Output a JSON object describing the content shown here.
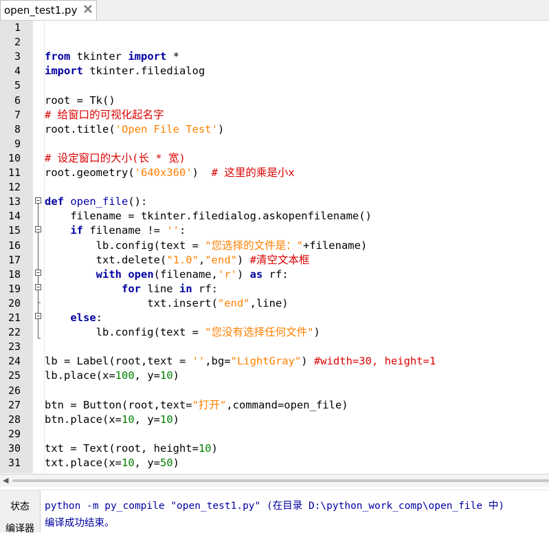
{
  "tab": {
    "filename": "open_test1.py",
    "close_icon": "close-x-icon"
  },
  "editor": {
    "line_numbers": [
      "1",
      "2",
      "3",
      "4",
      "5",
      "6",
      "7",
      "8",
      "9",
      "10",
      "11",
      "12",
      "13",
      "14",
      "15",
      "16",
      "17",
      "18",
      "19",
      "20",
      "21",
      "22",
      "23",
      "24",
      "25",
      "26",
      "27",
      "28",
      "29",
      "30",
      "31"
    ],
    "lines": [
      [],
      [],
      [
        [
          "kw",
          "from"
        ],
        [
          "op",
          " tkinter "
        ],
        [
          "kw",
          "import"
        ],
        [
          "op",
          " *"
        ]
      ],
      [
        [
          "kw",
          "import"
        ],
        [
          "op",
          " tkinter.filedialog"
        ]
      ],
      [],
      [
        [
          "op",
          "root = Tk()"
        ]
      ],
      [
        [
          "cm",
          "# 给窗口的可视化起名字"
        ]
      ],
      [
        [
          "op",
          "root.title("
        ],
        [
          "str",
          "'Open File Test'"
        ],
        [
          "op",
          ")"
        ]
      ],
      [],
      [
        [
          "cm",
          "# 设定窗口的大小(长 * 宽)"
        ]
      ],
      [
        [
          "op",
          "root.geometry("
        ],
        [
          "str",
          "'640x360'"
        ],
        [
          "op",
          ")  "
        ],
        [
          "cm",
          "# 这里的乘是小x"
        ]
      ],
      [],
      [
        [
          "kw",
          "def"
        ],
        [
          "op",
          " "
        ],
        [
          "bi",
          "open_file"
        ],
        [
          "op",
          "():"
        ]
      ],
      [
        [
          "op",
          "    filename = tkinter.filedialog.askopenfilename()"
        ]
      ],
      [
        [
          "op",
          "    "
        ],
        [
          "kw",
          "if"
        ],
        [
          "op",
          " filename != "
        ],
        [
          "str",
          "''"
        ],
        [
          "op",
          ":"
        ]
      ],
      [
        [
          "op",
          "        lb.config(text = "
        ],
        [
          "str",
          "\"您选择的文件是：\""
        ],
        [
          "op",
          "+filename)"
        ]
      ],
      [
        [
          "op",
          "        txt.delete("
        ],
        [
          "str",
          "\"1.0\""
        ],
        [
          "op",
          ","
        ],
        [
          "str",
          "\"end\""
        ],
        [
          "op",
          ") "
        ],
        [
          "cm",
          "#清空文本框"
        ]
      ],
      [
        [
          "op",
          "        "
        ],
        [
          "kw",
          "with"
        ],
        [
          "op",
          " "
        ],
        [
          "kw",
          "open"
        ],
        [
          "op",
          "(filename,"
        ],
        [
          "str",
          "'r'"
        ],
        [
          "op",
          ") "
        ],
        [
          "kw",
          "as"
        ],
        [
          "op",
          " rf:"
        ]
      ],
      [
        [
          "op",
          "            "
        ],
        [
          "kw",
          "for"
        ],
        [
          "op",
          " line "
        ],
        [
          "kw",
          "in"
        ],
        [
          "op",
          " rf:"
        ]
      ],
      [
        [
          "op",
          "                txt.insert("
        ],
        [
          "str",
          "\"end\""
        ],
        [
          "op",
          ",line)"
        ]
      ],
      [
        [
          "op",
          "    "
        ],
        [
          "kw",
          "else"
        ],
        [
          "op",
          ":"
        ]
      ],
      [
        [
          "op",
          "        lb.config(text = "
        ],
        [
          "str",
          "\"您没有选择任何文件\""
        ],
        [
          "op",
          ")"
        ]
      ],
      [],
      [
        [
          "op",
          "lb = Label(root,text = "
        ],
        [
          "str",
          "''"
        ],
        [
          "op",
          ",bg="
        ],
        [
          "str",
          "\"LightGray\""
        ],
        [
          "op",
          ") "
        ],
        [
          "cm",
          "#width=30, height=1"
        ]
      ],
      [
        [
          "op",
          "lb.place(x="
        ],
        [
          "num",
          "100"
        ],
        [
          "op",
          ", y="
        ],
        [
          "num",
          "10"
        ],
        [
          "op",
          ")"
        ]
      ],
      [],
      [
        [
          "op",
          "btn = Button(root,text="
        ],
        [
          "str",
          "\"打开\""
        ],
        [
          "op",
          ",command=open_file)"
        ]
      ],
      [
        [
          "op",
          "btn.place(x="
        ],
        [
          "num",
          "10"
        ],
        [
          "op",
          ", y="
        ],
        [
          "num",
          "10"
        ],
        [
          "op",
          ")"
        ]
      ],
      [],
      [
        [
          "op",
          "txt = Text(root, height="
        ],
        [
          "num",
          "10"
        ],
        [
          "op",
          ")"
        ]
      ],
      [
        [
          "op",
          "txt.place(x="
        ],
        [
          "num",
          "10"
        ],
        [
          "op",
          ", y="
        ],
        [
          "num",
          "50"
        ],
        [
          "op",
          ")"
        ]
      ]
    ]
  },
  "bottom_panel": {
    "tabs": [
      "状态",
      "编译器"
    ],
    "output_lines": [
      "python -m py_compile \"open_test1.py\" (在目录 D:\\python_work_comp\\open_file 中)",
      "编译成功结束。"
    ]
  },
  "colors": {
    "keyword": "#0000a0",
    "string": "#ff8000",
    "comment": "#dd0000",
    "number": "#008000"
  }
}
